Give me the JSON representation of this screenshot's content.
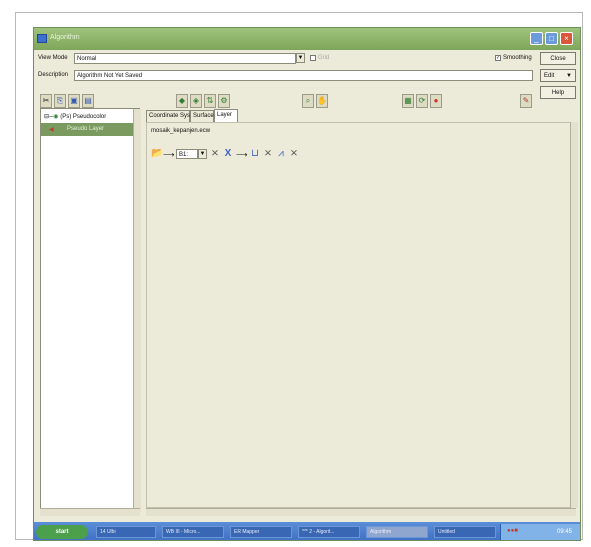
{
  "window": {
    "title": "Algorithm"
  },
  "view_mode": {
    "label": "View Mode",
    "value": "Normal",
    "grid_label": "Grid"
  },
  "smoothing": {
    "label": "Smoothing",
    "checked": true
  },
  "description": {
    "label": "Description",
    "value": "Algorithm Not Yet Saved"
  },
  "buttons": {
    "close": "Close",
    "edit": "Edit",
    "help": "Help"
  },
  "tree": {
    "root": "(Ps) Pseudocolor",
    "child": "Pseudo Layer"
  },
  "tabs": [
    "Coordinate System",
    "Surface",
    "Layer"
  ],
  "layer": {
    "file": "mosaik_kepanjen.ecw",
    "band": "B1:"
  },
  "taskbar": {
    "start": "start",
    "tasks": [
      "14 Ulbi",
      "WB III - Micro...",
      "ER Mapper",
      "*** 2 - Algorit...",
      "Algorithm",
      "Untitled"
    ],
    "time": "09:45"
  }
}
